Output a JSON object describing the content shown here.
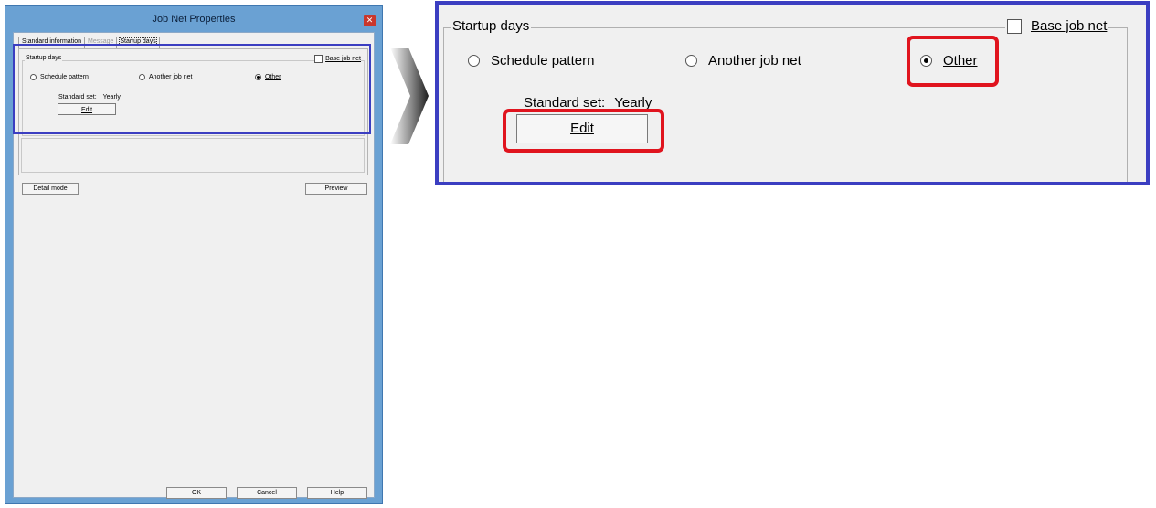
{
  "dialog": {
    "title": "Job Net Properties",
    "close_glyph": "✕",
    "tabs": [
      {
        "label": "Standard information",
        "state": "normal"
      },
      {
        "label": "Message",
        "state": "disabled"
      },
      {
        "label": "Startup days",
        "state": "active"
      }
    ],
    "startup_days": {
      "legend": "Startup days",
      "base_job_net_label": "Base job net",
      "base_job_net_checked": false,
      "radios": [
        {
          "label": "Schedule pattern",
          "selected": false
        },
        {
          "label": "Another job net",
          "selected": false
        },
        {
          "label": "Other",
          "selected": true
        }
      ],
      "standard_set_label": "Standard set:",
      "standard_set_value": "Yearly",
      "edit_label": "Edit"
    },
    "detail_mode_label": "Detail mode",
    "preview_label": "Preview",
    "ok_label": "OK",
    "cancel_label": "Cancel",
    "help_label": "Help"
  },
  "zoom": {
    "legend": "Startup days",
    "base_job_net_label": "Base job net",
    "radios": [
      {
        "label": "Schedule pattern",
        "selected": false
      },
      {
        "label": "Another job net",
        "selected": false
      },
      {
        "label": "Other",
        "selected": true
      }
    ],
    "standard_set_label": "Standard set:",
    "standard_set_value": "Yearly",
    "edit_label": "Edit"
  },
  "colors": {
    "highlight_blue": "#3b3ec1",
    "highlight_red": "#e0141e",
    "window_frame": "#6aa1d3"
  }
}
